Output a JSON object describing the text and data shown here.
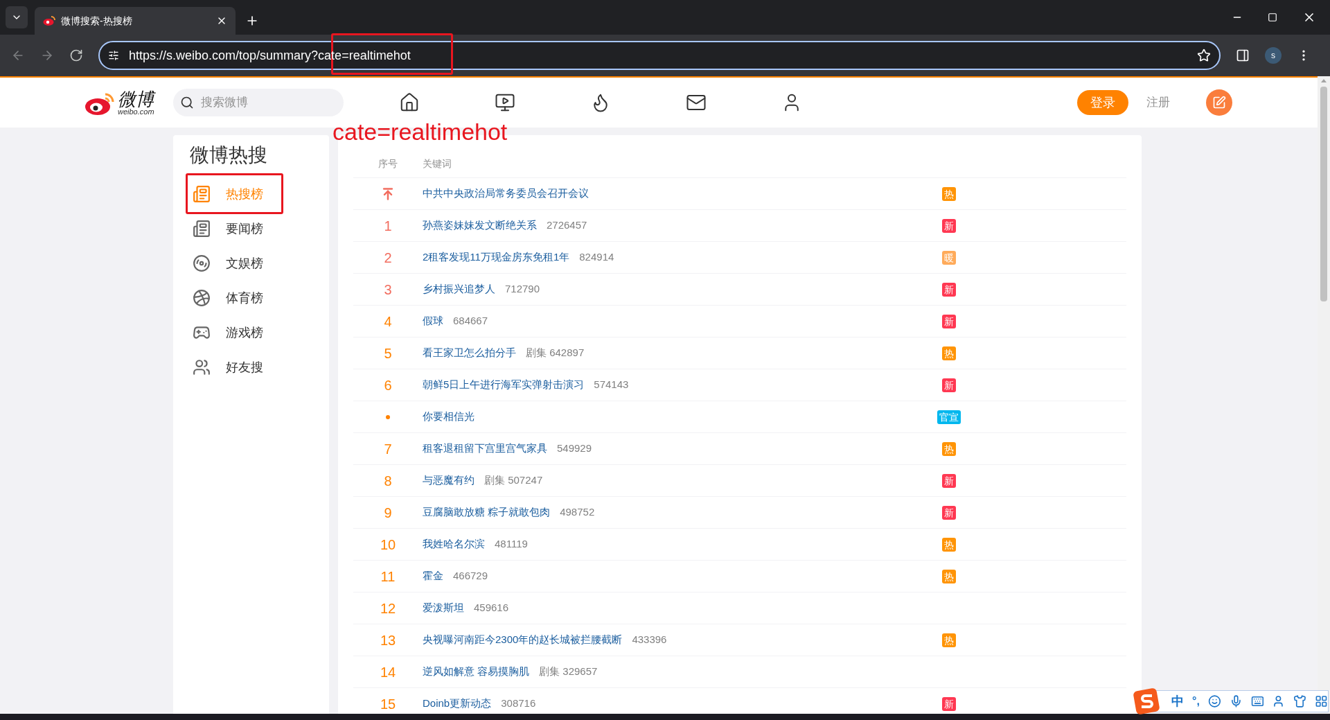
{
  "browser": {
    "tab_title": "微博搜索-热搜榜",
    "url": "https://s.weibo.com/top/summary?cate=realtimehot",
    "profile_initial": "s"
  },
  "annotation": {
    "label": "cate=realtimehot"
  },
  "header": {
    "logo_text": "微博",
    "logo_sub": "weibo.com",
    "search_placeholder": "搜索微博",
    "login": "登录",
    "register": "注册"
  },
  "sidebar": {
    "title": "微博热搜",
    "items": [
      {
        "label": "热搜榜",
        "selected": true
      },
      {
        "label": "要闻榜",
        "selected": false
      },
      {
        "label": "文娱榜",
        "selected": false
      },
      {
        "label": "体育榜",
        "selected": false
      },
      {
        "label": "游戏榜",
        "selected": false
      },
      {
        "label": "好友搜",
        "selected": false
      }
    ]
  },
  "table": {
    "columns": [
      "序号",
      "关键词"
    ],
    "rows": [
      {
        "kind": "pinned",
        "keyword": "中共中央政治局常务委员会召开会议",
        "badge": {
          "text": "热",
          "color": "#ff9406"
        }
      },
      {
        "kind": "rank",
        "rank": "1",
        "keyword": "孙燕姿妹妹发文断绝关系",
        "heat": "2726457",
        "badge": {
          "text": "新",
          "color": "#ff3852"
        }
      },
      {
        "kind": "rank",
        "rank": "2",
        "keyword": "2租客发现11万现金房东免租1年",
        "heat": "824914",
        "badge": {
          "text": "暖",
          "color": "#ffab5a"
        }
      },
      {
        "kind": "rank",
        "rank": "3",
        "keyword": "乡村振兴追梦人",
        "heat": "712790",
        "badge": {
          "text": "新",
          "color": "#ff3852"
        }
      },
      {
        "kind": "rank",
        "rank": "4",
        "keyword": "假球",
        "heat": "684667",
        "badge": {
          "text": "新",
          "color": "#ff3852"
        }
      },
      {
        "kind": "rank",
        "rank": "5",
        "keyword": "看王家卫怎么拍分手",
        "heat": "剧集 642897",
        "badge": {
          "text": "热",
          "color": "#ff9406"
        }
      },
      {
        "kind": "rank",
        "rank": "6",
        "keyword": "朝鲜5日上午进行海军实弹射击演习",
        "heat": "574143",
        "badge": {
          "text": "新",
          "color": "#ff3852"
        }
      },
      {
        "kind": "promo",
        "keyword": "你要相信光",
        "badge": {
          "text": "官宣",
          "color": "#00b7ee"
        }
      },
      {
        "kind": "rank",
        "rank": "7",
        "keyword": "租客退租留下宫里宫气家具",
        "heat": "549929",
        "badge": {
          "text": "热",
          "color": "#ff9406"
        }
      },
      {
        "kind": "rank",
        "rank": "8",
        "keyword": "与恶魔有约",
        "heat": "剧集 507247",
        "badge": {
          "text": "新",
          "color": "#ff3852"
        }
      },
      {
        "kind": "rank",
        "rank": "9",
        "keyword": "豆腐脑敢放糖 粽子就敢包肉",
        "heat": "498752",
        "badge": {
          "text": "新",
          "color": "#ff3852"
        }
      },
      {
        "kind": "rank",
        "rank": "10",
        "keyword": "我姓哈名尔滨",
        "heat": "481119",
        "badge": {
          "text": "热",
          "color": "#ff9406"
        }
      },
      {
        "kind": "rank",
        "rank": "11",
        "keyword": "霍金",
        "heat": "466729",
        "badge": {
          "text": "热",
          "color": "#ff9406"
        }
      },
      {
        "kind": "rank",
        "rank": "12",
        "keyword": "爱泼斯坦",
        "heat": "459616"
      },
      {
        "kind": "rank",
        "rank": "13",
        "keyword": "央视曝河南距今2300年的赵长城被拦腰截断",
        "heat": "433396",
        "badge": {
          "text": "热",
          "color": "#ff9406"
        }
      },
      {
        "kind": "rank",
        "rank": "14",
        "keyword": "逆风如解意 容易摸胸肌",
        "heat": "剧集 329657"
      },
      {
        "kind": "rank",
        "rank": "15",
        "keyword": "Doinb更新动态",
        "heat": "308716",
        "badge": {
          "text": "新",
          "color": "#ff3852"
        }
      }
    ]
  },
  "ime": {
    "lang": "中",
    "punct": "°,"
  }
}
